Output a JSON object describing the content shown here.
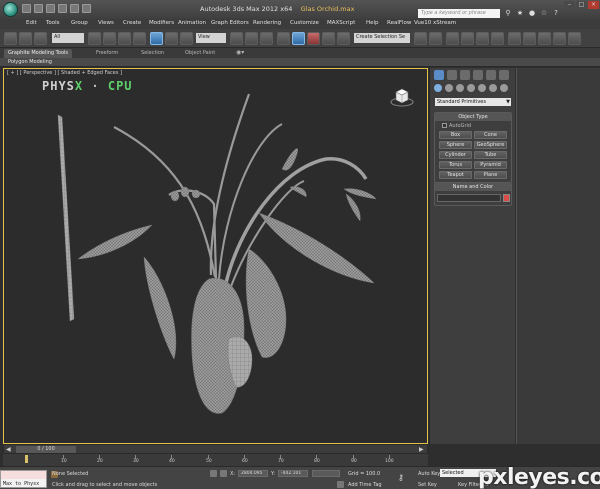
{
  "window": {
    "title": "Autodesk 3ds Max  2012 x64",
    "file_name": "Glas Orchid.max",
    "search_placeholder": "Type a keyword or phrase"
  },
  "menu": [
    "Edit",
    "Tools",
    "Group",
    "Views",
    "Create",
    "Modifiers",
    "Animation",
    "Graph Editors",
    "Rendering",
    "Customize",
    "MAXScript",
    "Help",
    "RealFlow",
    "Vue10 xStream"
  ],
  "toolbar": {
    "selection_filter": "All",
    "reference_coord": "View",
    "named_selection": "Create Selection Se"
  },
  "ribbon": {
    "tabs": [
      "Graphite Modeling Tools",
      "Freeform",
      "Selection",
      "Object Paint"
    ],
    "sub_label": "Polygon Modeling"
  },
  "viewport": {
    "label": "[ + ] [ Perspective ] [ Shaded + Edged Faces ]",
    "physx_word": "PHYS",
    "physx_x": "X",
    "physx_sep": "·",
    "physx_cpu": "CPU"
  },
  "command_panel": {
    "dropdown": "Standard Primitives",
    "object_type_title": "Object Type",
    "autogrid": "AutoGrid",
    "primitives": [
      "Box",
      "Cone",
      "Sphere",
      "GeoSphere",
      "Cylinder",
      "Tube",
      "Torus",
      "Pyramid",
      "Teapot",
      "Plane"
    ],
    "name_color_title": "Name and Color",
    "color": "#d84b46"
  },
  "timeline": {
    "frame": "0 / 100",
    "ticks": [
      "10",
      "20",
      "30",
      "40",
      "50",
      "60",
      "70",
      "80",
      "90",
      "100"
    ]
  },
  "status": {
    "maxscript": "Max to Physx",
    "selection": "None Selected",
    "prompt": "Click and drag to select and move objects",
    "x_label": "X:",
    "x_value": "2804.095",
    "y_label": "Y:",
    "y_value": "-442.101",
    "grid": "Grid = 100.0",
    "add_time_tag": "Add Time Tag",
    "auto_key": "Auto Key",
    "set_key": "Set Key",
    "key_mode": "Selected",
    "key_filters": "Key Filters..."
  },
  "watermark": "pxleyes.com"
}
